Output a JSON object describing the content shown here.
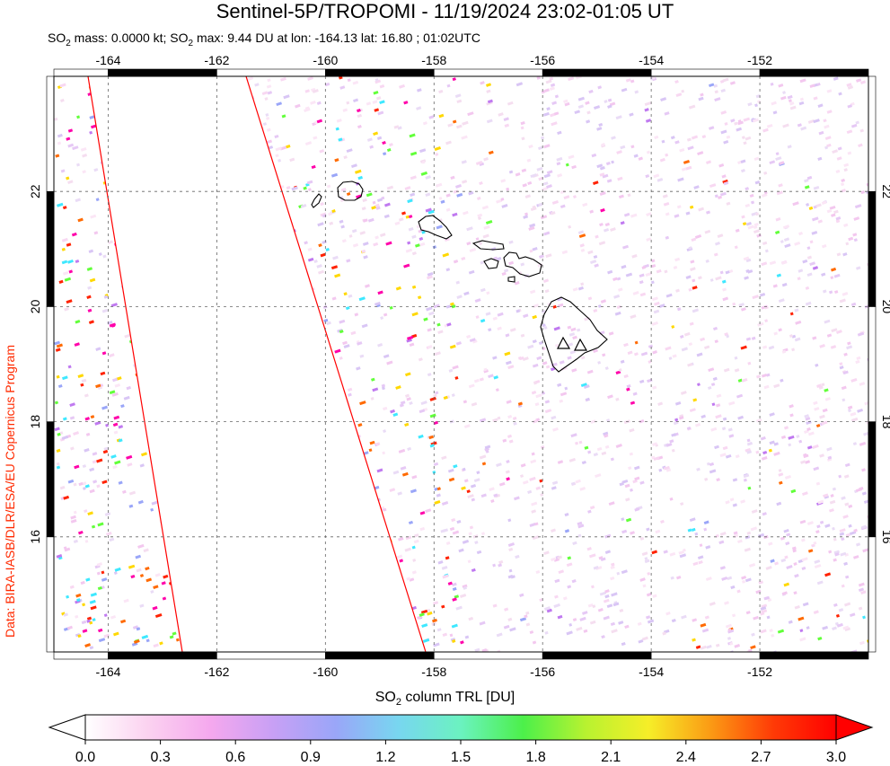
{
  "title": "Sentinel-5P/TROPOMI - 11/19/2024 23:02-01:05 UT",
  "subtitle": {
    "p1": "SO",
    "p1sub": "2",
    "p2": " mass: 0.0000 kt; SO",
    "p2sub": "2",
    "p3": " max: 9.44 DU at lon: -164.13 lat: 16.80 ; 01:02UTC"
  },
  "credit": "Data: BIRA-IASB/DLR/ESA/EU Copernicus Program",
  "map": {
    "lon_range": [
      -165,
      -150
    ],
    "lat_range": [
      14,
      24
    ],
    "lon_ticks": [
      -164,
      -162,
      -160,
      -158,
      -156,
      -154,
      -152
    ],
    "lat_ticks": [
      16,
      18,
      20,
      22
    ],
    "lon_tick_labels": [
      "-164",
      "-162",
      "-160",
      "-158",
      "-156",
      "-154",
      "-152"
    ],
    "lat_tick_labels": [
      "16",
      "18",
      "20",
      "22"
    ],
    "gridlines": true,
    "swath_edge_color": "#ff0000",
    "coastline_color": "#000000",
    "volcano_markers": "triangle-icon"
  },
  "colorbar": {
    "title_main": "SO",
    "title_sub": "2",
    "title_rest": " column TRL [DU]",
    "range": [
      0.0,
      3.0
    ],
    "tick_labels": [
      "0.0",
      "0.3",
      "0.6",
      "0.9",
      "1.2",
      "1.5",
      "1.8",
      "2.1",
      "2.4",
      "2.7",
      "3.0"
    ],
    "colors": [
      "#ffffff",
      "#fbd2f0",
      "#f5a8ee",
      "#c8a0f5",
      "#9aa6f8",
      "#78d6f0",
      "#6bf2c0",
      "#4cf04a",
      "#b8f230",
      "#f6ee28",
      "#fb9a14",
      "#ff3a06",
      "#ff0000"
    ]
  }
}
